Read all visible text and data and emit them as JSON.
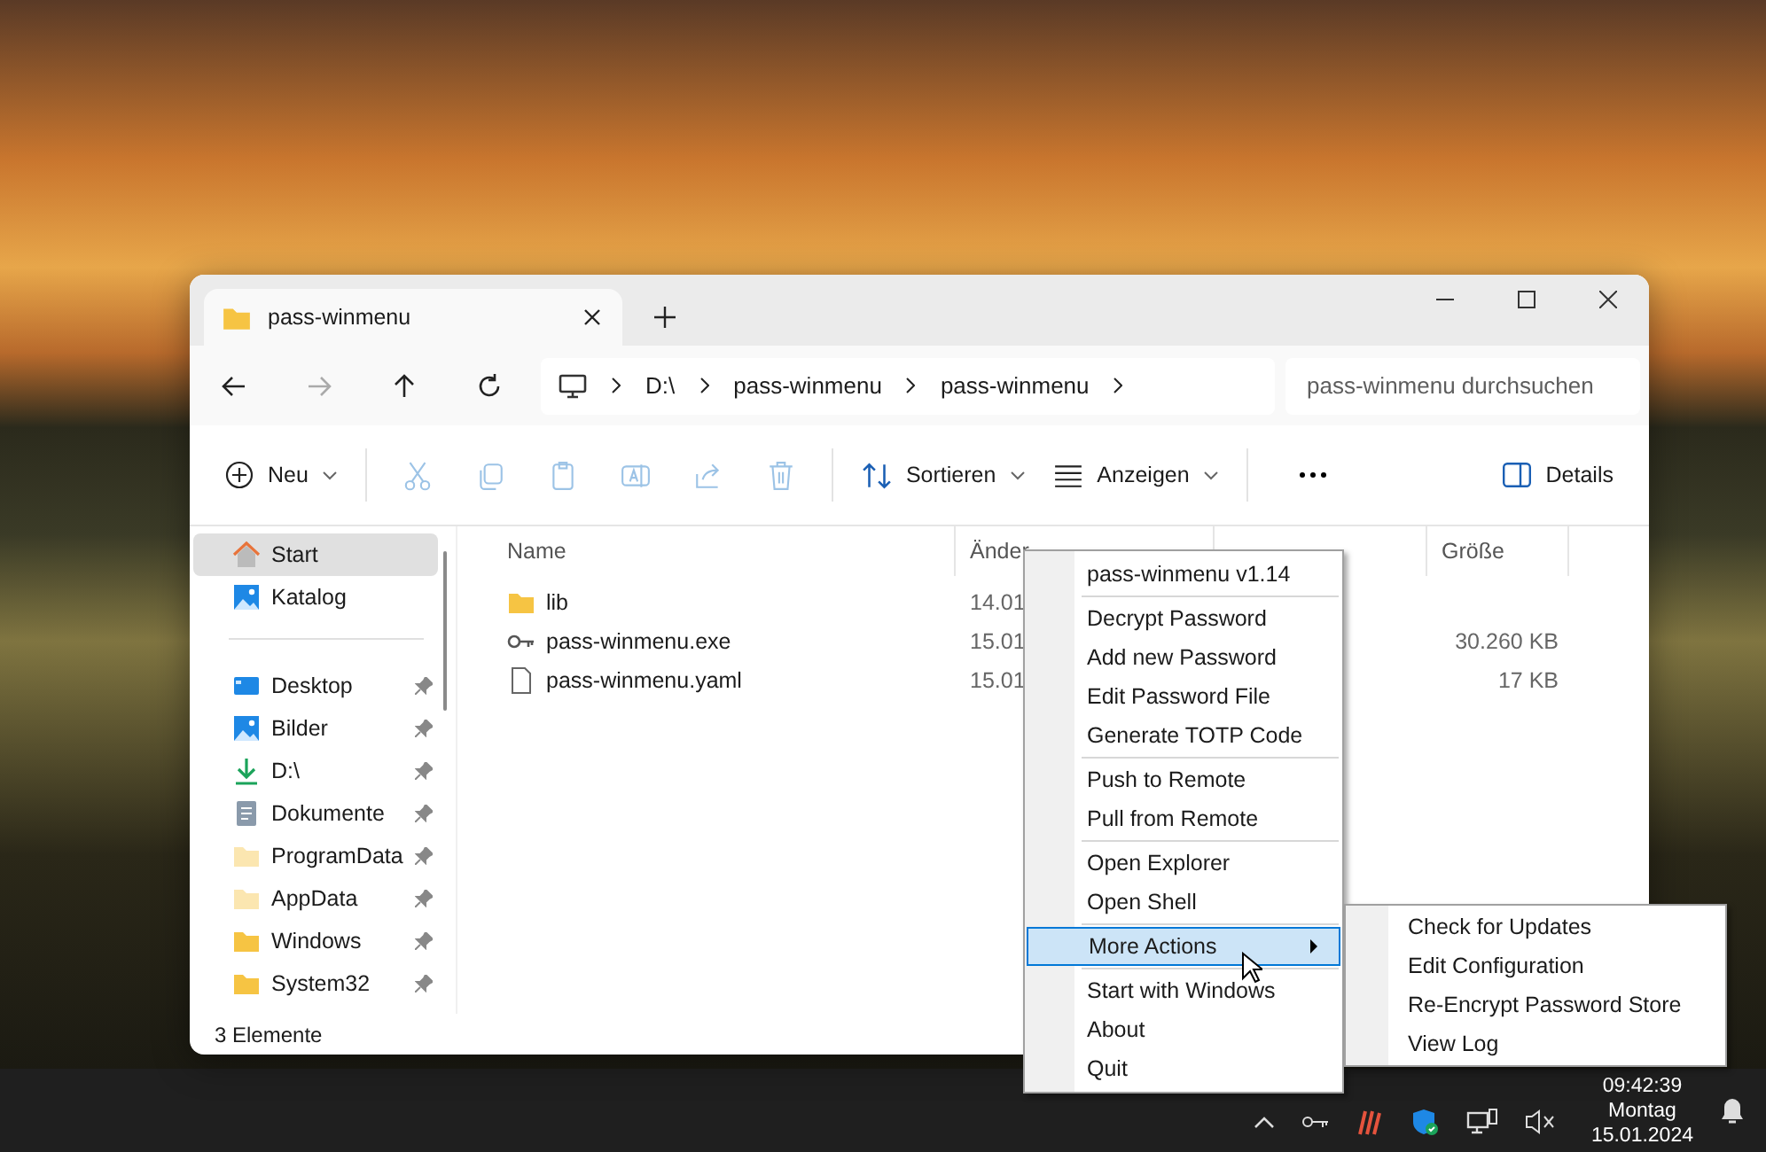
{
  "window": {
    "tab_title": "pass-winmenu",
    "address": [
      "D:\\",
      "pass-winmenu",
      "pass-winmenu"
    ],
    "search": {
      "placeholder": "pass-winmenu durchsuchen"
    },
    "toolbar": {
      "new_label": "Neu",
      "actions": [
        {
          "kind": "cut",
          "disabled": true
        },
        {
          "kind": "copy",
          "disabled": true
        },
        {
          "kind": "paste",
          "disabled": true
        },
        {
          "kind": "rename",
          "disabled": true
        },
        {
          "kind": "share",
          "disabled": true
        },
        {
          "kind": "delete",
          "disabled": true
        }
      ],
      "sort_label": "Sortieren",
      "view_label": "Anzeigen",
      "details_label": "Details"
    },
    "sidebar": {
      "items": [
        {
          "kind": "home",
          "label": "Start",
          "selected": true,
          "pinned": false
        },
        {
          "kind": "gallery",
          "label": "Katalog",
          "selected": false,
          "pinned": false
        },
        {
          "kind": "separator"
        },
        {
          "kind": "desktop",
          "label": "Desktop",
          "selected": false,
          "pinned": true
        },
        {
          "kind": "pictures",
          "label": "Bilder",
          "selected": false,
          "pinned": true
        },
        {
          "kind": "download",
          "label": "D:\\",
          "selected": false,
          "pinned": true
        },
        {
          "kind": "documents",
          "label": "Dokumente",
          "selected": false,
          "pinned": true
        },
        {
          "kind": "folder",
          "label": "ProgramData",
          "selected": false,
          "pinned": true,
          "hidden": true
        },
        {
          "kind": "folder",
          "label": "AppData",
          "selected": false,
          "pinned": true,
          "hidden": true
        },
        {
          "kind": "folder",
          "label": "Windows",
          "selected": false,
          "pinned": true,
          "hidden": false
        },
        {
          "kind": "folder",
          "label": "System32",
          "selected": false,
          "pinned": true,
          "hidden": false
        }
      ]
    },
    "table": {
      "columns": [
        "Name",
        "Änder",
        "Größe"
      ],
      "rows": [
        {
          "kind": "folder",
          "name": "lib",
          "date": "14.01"
        },
        {
          "kind": "key",
          "name": "pass-winmenu.exe",
          "date": "15.01",
          "size": "30.260 KB"
        },
        {
          "kind": "file",
          "name": "pass-winmenu.yaml",
          "date": "15.01",
          "size": "17 KB"
        }
      ]
    },
    "status_bar": "3 Elemente"
  },
  "context_menu": {
    "groups": [
      [
        {
          "label": "pass-winmenu v1.14",
          "selected": false
        }
      ],
      [
        {
          "label": "Decrypt Password",
          "selected": false
        },
        {
          "label": "Add new Password",
          "selected": false
        },
        {
          "label": "Edit Password File",
          "selected": false
        },
        {
          "label": "Generate TOTP Code",
          "selected": false
        }
      ],
      [
        {
          "label": "Push to Remote",
          "selected": false
        },
        {
          "label": "Pull from Remote",
          "selected": false
        }
      ],
      [
        {
          "label": "Open Explorer",
          "selected": false
        },
        {
          "label": "Open Shell",
          "selected": false
        }
      ],
      [
        {
          "label": "More Actions",
          "selected": true,
          "submenu": true
        }
      ],
      [
        {
          "label": "Start with Windows",
          "selected": false
        },
        {
          "label": "About",
          "selected": false
        },
        {
          "label": "Quit",
          "selected": false
        }
      ]
    ],
    "submenu": [
      "Check for Updates",
      "Edit Configuration",
      "Re-Encrypt Password Store",
      "View Log"
    ]
  },
  "taskbar": {
    "time": "09:42:39",
    "day": "Montag",
    "date": "15.01.2024"
  }
}
